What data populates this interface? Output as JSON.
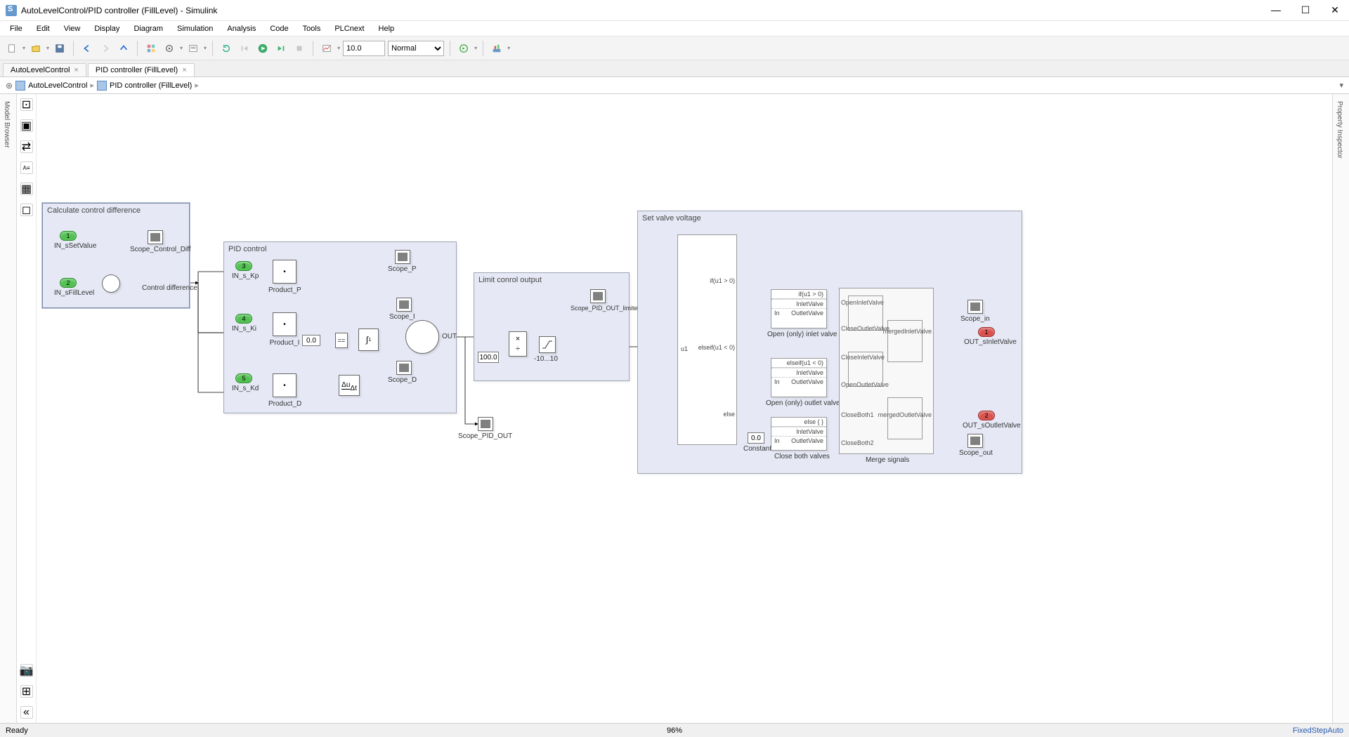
{
  "window": {
    "title": "AutoLevelControl/PID controller (FillLevel) - Simulink"
  },
  "menus": [
    "File",
    "Edit",
    "View",
    "Display",
    "Diagram",
    "Simulation",
    "Analysis",
    "Code",
    "Tools",
    "PLCnext",
    "Help"
  ],
  "toolbar": {
    "stop_time": "10.0",
    "mode": "Normal"
  },
  "tabs": [
    {
      "label": "AutoLevelControl",
      "active": false
    },
    {
      "label": "PID controller (FillLevel)",
      "active": true
    }
  ],
  "breadcrumbs": [
    "AutoLevelControl",
    "PID controller (FillLevel)"
  ],
  "left_panel": "Model Browser",
  "right_panel": "Property Inspector",
  "status": {
    "ready": "Ready",
    "zoom": "96%",
    "solver": "FixedStepAuto"
  },
  "subsystems": {
    "calc": "Calculate control difference",
    "pid": "PID control",
    "limit": "Limit conrol output",
    "valve": "Set valve voltage"
  },
  "ports": {
    "in1": "1",
    "in1_lbl": "IN_sSetValue",
    "in2": "2",
    "in2_lbl": "IN_sFillLevel",
    "in3": "3",
    "in3_lbl": "IN_s_Kp",
    "in4": "4",
    "in4_lbl": "IN_s_Ki",
    "in5": "5",
    "in5_lbl": "IN_s_Kd",
    "out1": "1",
    "out1_lbl": "OUT_sInletValve",
    "out2": "2",
    "out2_lbl": "OUT_sOutletValve"
  },
  "blocks": {
    "scope_ctrl": "Scope_Control_Diff",
    "ctrl_diff_sig": "Control difference",
    "prod_p": "Product_P",
    "prod_i": "Product_I",
    "prod_d": "Product_D",
    "ic0": "0.0",
    "scope_p": "Scope_P",
    "scope_i": "Scope_I",
    "scope_d": "Scope_D",
    "out_lbl": "OUT",
    "limit_const": "100.0",
    "sat_lbl": "-10...10",
    "scope_pid_limited": "Scope_PID_OUT_limited",
    "scope_pid": "Scope_PID_OUT",
    "if_u1": "u1",
    "if_cond1": "if(u1 > 0)",
    "if_cond2": "elseif(u1 < 0)",
    "if_cond3": "else",
    "act1_hdr": "if(u1 > 0)",
    "act1_in": "In",
    "act1_p1": "InletValve",
    "act1_p2": "OutletValve",
    "act1_lbl": "Open (only) inlet valve",
    "act2_hdr": "elseif(u1 < 0)",
    "act2_p1": "InletValve",
    "act2_p2": "OutletValve",
    "act2_lbl": "Open (only) outlet valve",
    "act3_hdr": "else { }",
    "act3_p1": "InletValve",
    "act3_p2": "OutletValve",
    "act3_lbl": "Close both valves",
    "const0": "0.0",
    "const0_lbl": "Constant",
    "merge_lbl": "Merge signals",
    "m_open_in": "OpenInletValve",
    "m_close_out": "CloseOutletValve",
    "m_close_in": "CloseInletValve",
    "m_open_out": "OpenOutletValve",
    "m_both1": "CloseBoth1",
    "m_both2": "CloseBoth2",
    "m_out1": "mergedInletValve",
    "m_out2": "mergedOutletValve",
    "scope_in": "Scope_in",
    "scope_out": "Scope_out",
    "deriv": "Δu/Δt"
  }
}
